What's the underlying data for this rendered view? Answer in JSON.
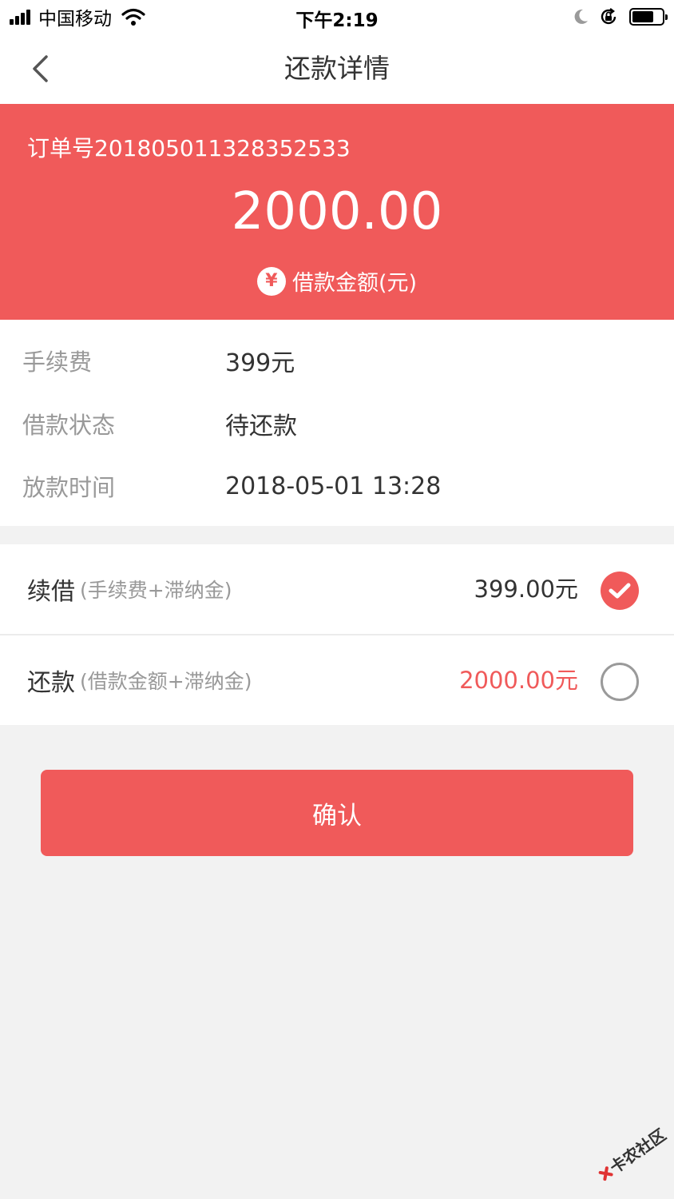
{
  "status_bar": {
    "carrier": "中国移动",
    "time": "下午2:19",
    "battery_level": 0.75
  },
  "nav": {
    "title": "还款详情"
  },
  "hero": {
    "order_no": "订单号201805011328352533",
    "amount": "2000.00",
    "amount_icon": "¥",
    "amount_label": "借款金额(元)"
  },
  "info": [
    {
      "label": "手续费",
      "value": "399元"
    },
    {
      "label": "借款状态",
      "value": "待还款"
    },
    {
      "label": "放款时间",
      "value": "2018-05-01 13:28"
    }
  ],
  "options": [
    {
      "name": "续借",
      "note": "(手续费+滞纳金)",
      "amount": "399.00元",
      "amount_color": "#333333",
      "selected": true
    },
    {
      "name": "还款",
      "note": "(借款金额+滞纳金)",
      "amount": "2000.00元",
      "amount_color": "#f05a5a",
      "selected": false
    }
  ],
  "confirm_label": "确认",
  "colors": {
    "accent": "#f05a5a",
    "background": "#f2f2f2"
  },
  "watermark": "卡农社区"
}
